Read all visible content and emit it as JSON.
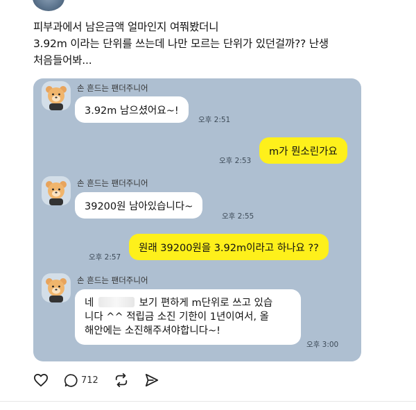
{
  "post": {
    "lines": [
      "피부과에서 남은금액 얼마인지 여쭤봤더니",
      "3.92m 이라는 단위를 쓰는데 나만 모르는 단위가 있던걸까?? 난생",
      "처음들어봐..."
    ]
  },
  "chat": {
    "messages": [
      {
        "sender": "손 흔드는 팬더주니어",
        "text": "3.92m 남으셨어요~!",
        "time": "오후 2:51"
      },
      {
        "text": "m가 뭔소린가요",
        "time": "오후 2:53"
      },
      {
        "sender": "손 흔드는 팬더주니어",
        "text": "39200원 남아있습니다~",
        "time": "오후 2:55"
      },
      {
        "text": "원래 39200원을 3.92m이라고 하나요 ??",
        "time": "오후 2:57"
      },
      {
        "sender": "손 흔드는 팬더주니어",
        "line1_start": "네",
        "line1_end": "보기 편하게 m단위로 쓰고 있습",
        "line2": "니다 ^^ 적립금 소진 기한이 1년이여서, 올",
        "line3": "해안에는 소진해주셔야합니다~!",
        "time": "오후 3:00"
      }
    ]
  },
  "actions": {
    "reply_count": "712"
  },
  "icons": [
    "heart-icon",
    "comment-icon",
    "repost-icon",
    "share-icon",
    "bear-avatar-icon"
  ]
}
